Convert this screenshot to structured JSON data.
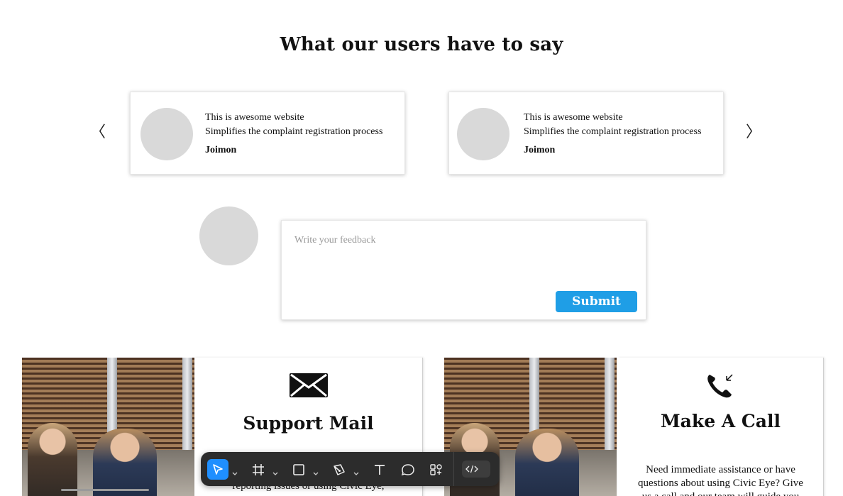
{
  "testimonials": {
    "heading": "What our users have to say",
    "prev_arrow": "〈",
    "next_arrow": "〉",
    "cards": [
      {
        "line1": "This is awesome website",
        "line2": "Simplifies the complaint registration process",
        "author": "Joimon"
      },
      {
        "line1": "This is awesome website",
        "line2": "Simplifies the complaint registration process",
        "author": "Joimon"
      }
    ]
  },
  "feedback": {
    "placeholder": "Write your feedback",
    "submit_label": "Submit",
    "accent": "#1f9ee6"
  },
  "contact": [
    {
      "icon": "envelope-icon",
      "title": "Support Mail",
      "description": "reporting issues or using Civic Eye,"
    },
    {
      "icon": "phone-icon",
      "title": "Make A Call",
      "description": "Need immediate assistance or have questions about using Civic Eye? Give us a call and our team will guide you through"
    }
  ],
  "toolbar": {
    "tools": [
      "move-tool-icon",
      "frame-tool-icon",
      "shape-tool-icon",
      "pen-tool-icon",
      "text-tool-icon",
      "comment-tool-icon",
      "actions-icon",
      "dev-mode-icon"
    ],
    "active_tool": "move-tool-icon",
    "active_color": "#1f8fff",
    "background": "#2c2c2c"
  }
}
